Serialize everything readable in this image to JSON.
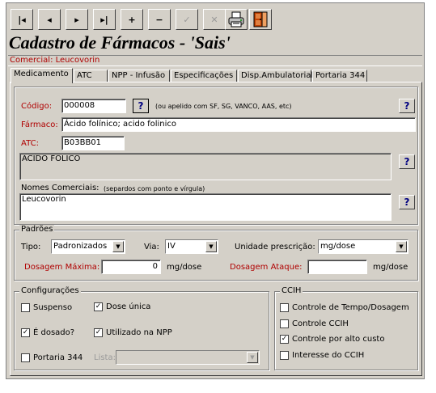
{
  "toolbar": {
    "first": "|◂",
    "prev": "◂",
    "next": "▸",
    "last": "▸|",
    "add": "+",
    "remove": "−",
    "confirm": "✓",
    "cancel": "✕"
  },
  "form": {
    "title": "Cadastro de Fármacos - 'Sais'",
    "commercial": "Comercial: Leucovorin"
  },
  "tabs": [
    "Medicamento",
    "ATC",
    "NPP - Infusão",
    "Especificações",
    "Disp.Ambulatorial",
    "Portaria 344"
  ],
  "medicamento": {
    "codigo_label": "Código:",
    "codigo_value": "000008",
    "codigo_hint": "(ou apelido com SF, SG, VANCO, AAS, etc)",
    "farmaco_label": "Fármaco:",
    "farmaco_value": "Ácido folínico; acido folinico",
    "atc_label": "ATC:",
    "atc_value": "B03BB01",
    "atc_desc": "ACIDO FOLICO",
    "nomes_label": "Nomes Comerciais:",
    "nomes_hint": "(separdos com ponto e vírgula)",
    "nomes_value": "Leucovorin",
    "help": "?"
  },
  "padroes": {
    "title": "Padrões",
    "tipo_label": "Tipo:",
    "tipo_value": "Padronizados",
    "via_label": "Via:",
    "via_value": "IV",
    "unidade_label": "Unidade prescrição:",
    "unidade_value": "mg/dose",
    "dosagem_max_label": "Dosagem Máxima:",
    "dosagem_max_value": "0",
    "dosagem_max_unit": "mg/dose",
    "dosagem_ataque_label": "Dosagem Ataque:",
    "dosagem_ataque_value": "",
    "dosagem_ataque_unit": "mg/dose"
  },
  "config": {
    "title": "Configurações",
    "suspenso": "Suspenso",
    "dose_unica": "Dose única",
    "e_dosado": "É dosado?",
    "utilizado_npp": "Utilizado na NPP",
    "portaria": "Portaria 344",
    "lista_label": "Lista:"
  },
  "ccih": {
    "title": "CCIH",
    "controle_tempo": "Controle de Tempo/Dosagem",
    "controle_ccih": "Controle CCIH",
    "controle_custo": "Controle por alto custo",
    "interesse": "Interesse do CCIH"
  }
}
